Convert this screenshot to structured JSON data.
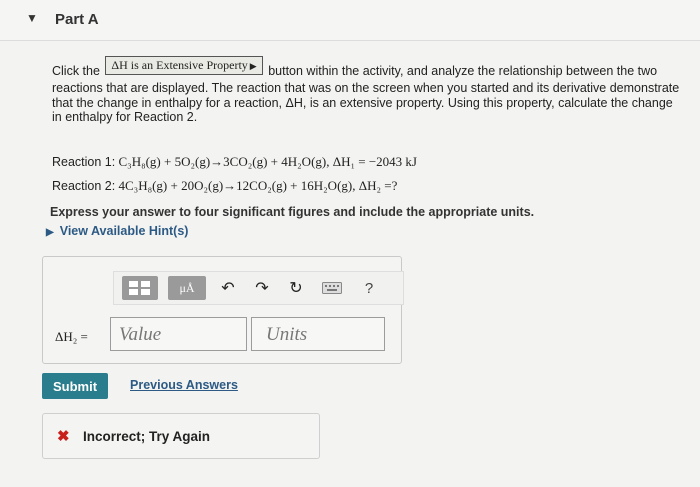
{
  "part": {
    "toggle_icon": "triangle-down-icon",
    "title": "Part A"
  },
  "instructions": {
    "prefix": "Click the",
    "property_button_label": "ΔH is an Extensive Property",
    "suffix": "button within the activity, and analyze the relationship between the two reactions that are displayed. The reaction that was on the screen when you started and its derivative demonstrate that the change in enthalpy for a reaction, ΔH, is an extensive property. Using this property, calculate the change in enthalpy for Reaction 2."
  },
  "reactions": [
    {
      "label": "Reaction 1:",
      "equation": "C₃H₈(g) + 5O₂(g)→3CO₂(g) + 4H₂O(g), ΔH₁ = −2043 kJ"
    },
    {
      "label": "Reaction 2:",
      "equation": "4C₃H₈(g) + 20O₂(g)→12CO₂(g) + 16H₂O(g), ΔH₂ =?"
    }
  ],
  "express_text": "Express your answer to four significant figures and include the appropriate units.",
  "hints_label": "View Available Hint(s)",
  "answer": {
    "label": "ΔH₂ =",
    "value_placeholder": "Value",
    "units_placeholder": "Units",
    "toolbar": {
      "mu_label": "μÅ",
      "help_label": "?"
    }
  },
  "submit_label": "Submit",
  "previous_answers_label": "Previous Answers",
  "feedback": {
    "icon": "x-icon",
    "text": "Incorrect; Try Again"
  },
  "colors": {
    "submit_bg": "#2a7d8c",
    "link": "#2c5a85",
    "error": "#c8201b"
  }
}
